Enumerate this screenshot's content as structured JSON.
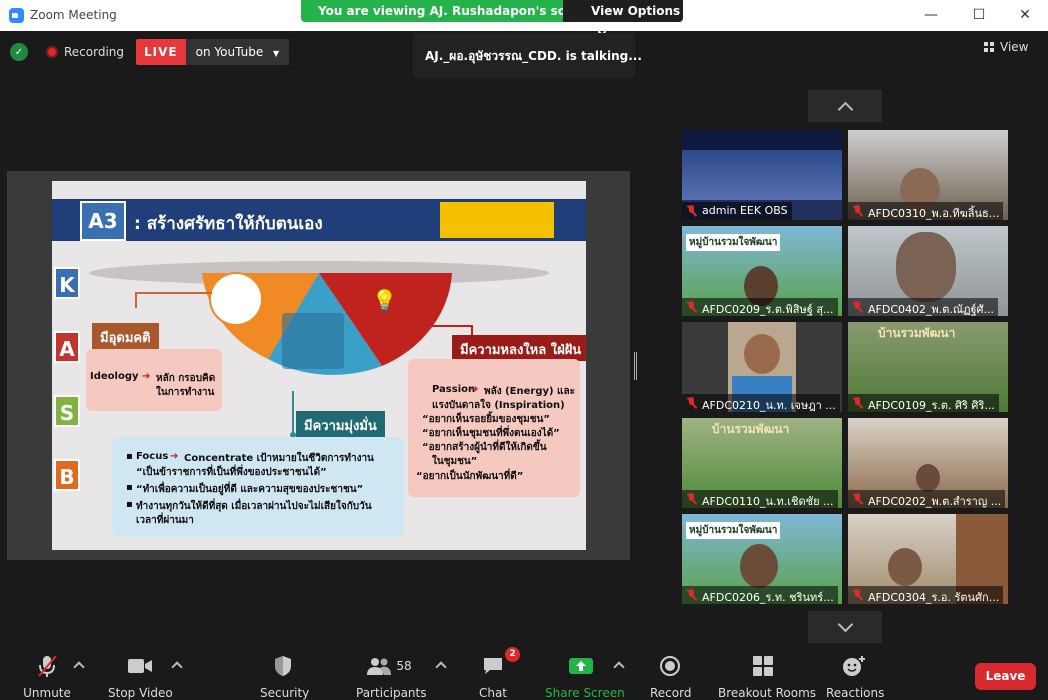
{
  "window": {
    "title": "Zoom Meeting",
    "viewing_banner": "You are viewing AJ. Rushadapon's screen",
    "view_options": "View Options",
    "minimize": "—",
    "maximize": "☐",
    "close": "✕"
  },
  "top_bar": {
    "recording": "Recording",
    "live": "LIVE",
    "live_on": "on YouTube",
    "talking": "AJ._ผอ.อุษัชวรรณ_CDD.  is  talking...",
    "view": "View"
  },
  "slide": {
    "badge": "A3",
    "title": ": สร้างศรัทธาให้กับตนเอง",
    "kasb": [
      "K",
      "A",
      "S",
      "B"
    ],
    "kasb_colors": [
      "#3a6fb3",
      "#c2342f",
      "#7fb441",
      "#e06a1e"
    ],
    "ideology_header": "มีอุดมคติ",
    "ideology_text_1": "Ideology",
    "ideology_text_2": "หลัก  กรอบคิด",
    "ideology_text_3": "ในการทำงาน",
    "commitment_header": "มีความมุ่งมั่น",
    "passion_header": "มีความหลงใหล ใฝ่ฝัน",
    "passion_lines": [
      "Passion",
      "พลัง (Energy) และ",
      "แรงบันดาลใจ (Inspiration)",
      "“อยากเห็นรอยยิ้มของชุมชน”",
      "“อยากเห็นชุมชนที่พึ่งตนเองได้”",
      "“อยากสร้างผู้นำที่ดีให้เกิดขึ้น",
      "ในชุมชน”",
      "“อยากเป็นนักพัฒนาที่ดี”"
    ],
    "focus_lines": [
      "Focus",
      "Concentrate เป้าหมายในชีวิตการทำงาน",
      "“เป็นข้าราชการที่เป็นที่พึ่งของประชาชนได้”",
      "“ทำเพื่อความเป็นอยู่ที่ดี และความสุขของประชาชน”",
      "ทำงานทุกวันให้ดีที่สุด เมื่อเวลาผ่านไปจะไม่เสียใจกับวัน",
      "เวลาที่ผ่านมา"
    ]
  },
  "participants_tiles": [
    {
      "name": "admin EEK OBS"
    },
    {
      "name": "AFDC0310_พ.อ.ทีฆลิ้นธ..."
    },
    {
      "name": "AFDC0209_ร.ต.พิสิษฐ์ สุ...",
      "overlay": "หมู่บ้านรวมใจพัฒนา"
    },
    {
      "name": "AFDC0402_พ.ต.ณัฏฐ์ศั..."
    },
    {
      "name": "AFDC0210_น.ท. เจษฎา ..."
    },
    {
      "name": "AFDC0109_ร.ต. ศิริ  ศิริ...",
      "overlay": "บ้านรวมพัฒนา"
    },
    {
      "name": "AFDC0110_น.ท.เชิดชัย ...",
      "overlay": "บ้านรวมพัฒนา"
    },
    {
      "name": "AFDC0202_พ.ต.สำราญ ..."
    },
    {
      "name": "AFDC0206_ร.ท. ชรินทร์...",
      "overlay": "หมู่บ้านรวมใจพัฒนา"
    },
    {
      "name": "AFDC0304_ร.อ. รัตนศัก..."
    }
  ],
  "toolbar": {
    "unmute": "Unmute",
    "stop_video": "Stop Video",
    "security": "Security",
    "participants": "Participants",
    "participants_count": "58",
    "chat": "Chat",
    "chat_badge": "2",
    "share_screen": "Share Screen",
    "record": "Record",
    "breakout_rooms": "Breakout Rooms",
    "reactions": "Reactions",
    "leave": "Leave"
  },
  "colors": {
    "share_green": "#24b34b",
    "live_red": "#e8383d",
    "leave_red": "#d8292f"
  }
}
